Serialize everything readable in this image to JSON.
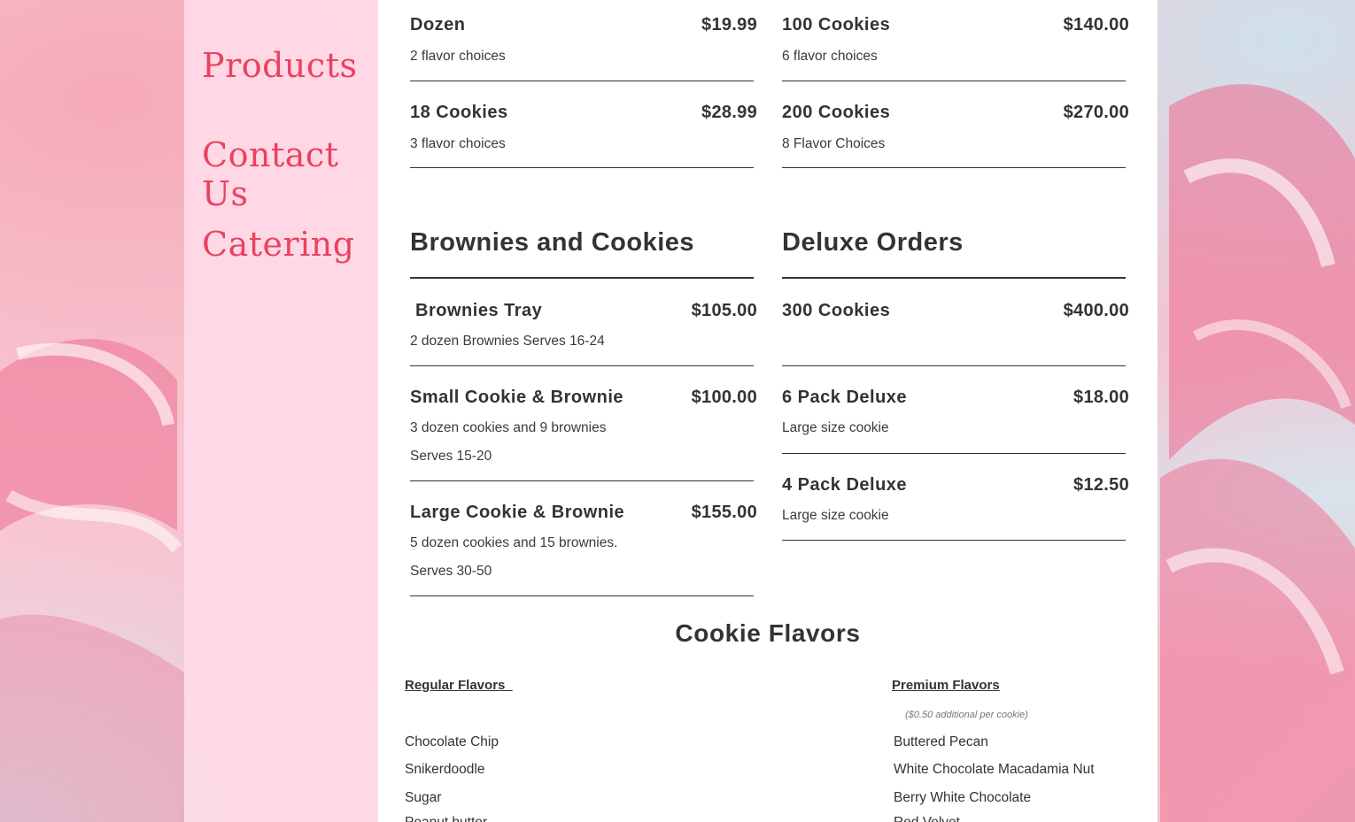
{
  "nav": {
    "items": [
      {
        "label": "Products"
      },
      {
        "label": "Contact Us"
      },
      {
        "label": "Catering"
      }
    ]
  },
  "catering": {
    "left_top_items": [
      {
        "name": "Dozen",
        "price": "$19.99",
        "desc": [
          "2 flavor choices"
        ]
      },
      {
        "name": "18 Cookies",
        "price": "$28.99",
        "desc": [
          "3 flavor choices"
        ]
      }
    ],
    "right_top_items": [
      {
        "name": "100 Cookies",
        "price": "$140.00",
        "desc": [
          "6 flavor choices"
        ]
      },
      {
        "name": "200 Cookies",
        "price": "$270.00",
        "desc": [
          "8 Flavor Choices"
        ]
      }
    ],
    "brownies_section": {
      "title": "Brownies and Cookies",
      "items": [
        {
          "name": " Brownies Tray",
          "price": "$105.00",
          "desc": [
            "2 dozen Brownies Serves 16-24"
          ]
        },
        {
          "name": "Small Cookie & Brownie",
          "price": "$100.00",
          "desc": [
            "3 dozen cookies  and 9 brownies",
            "Serves 15-20"
          ]
        },
        {
          "name": "Large Cookie & Brownie",
          "price": "$155.00",
          "desc": [
            "5 dozen cookies and 15 brownies.",
            "Serves 30-50"
          ]
        }
      ]
    },
    "deluxe_section": {
      "title": "Deluxe Orders",
      "items": [
        {
          "name": "300 Cookies",
          "price": "$400.00",
          "desc": []
        },
        {
          "name": "6 Pack Deluxe",
          "price": "$18.00",
          "desc": [
            "Large size cookie"
          ]
        },
        {
          "name": "4 Pack Deluxe",
          "price": "$12.50",
          "desc": [
            "Large size cookie"
          ]
        }
      ]
    }
  },
  "flavors": {
    "heading": "Cookie Flavors",
    "regular": {
      "title": "Regular Flavors  ",
      "items": [
        "Chocolate Chip",
        "Snikerdoodle",
        "Sugar",
        "Peanut butter"
      ]
    },
    "premium": {
      "title": "Premium Flavors",
      "note": "($0.50 additional per cookie)",
      "items": [
        "Buttered Pecan",
        "White Chocolate Macadamia Nut",
        "Berry White Chocolate",
        "Red Velvet"
      ]
    }
  },
  "colors": {
    "accent": "#e9425f",
    "text": "#333333",
    "sidebar_bg": "#ffdae8"
  }
}
